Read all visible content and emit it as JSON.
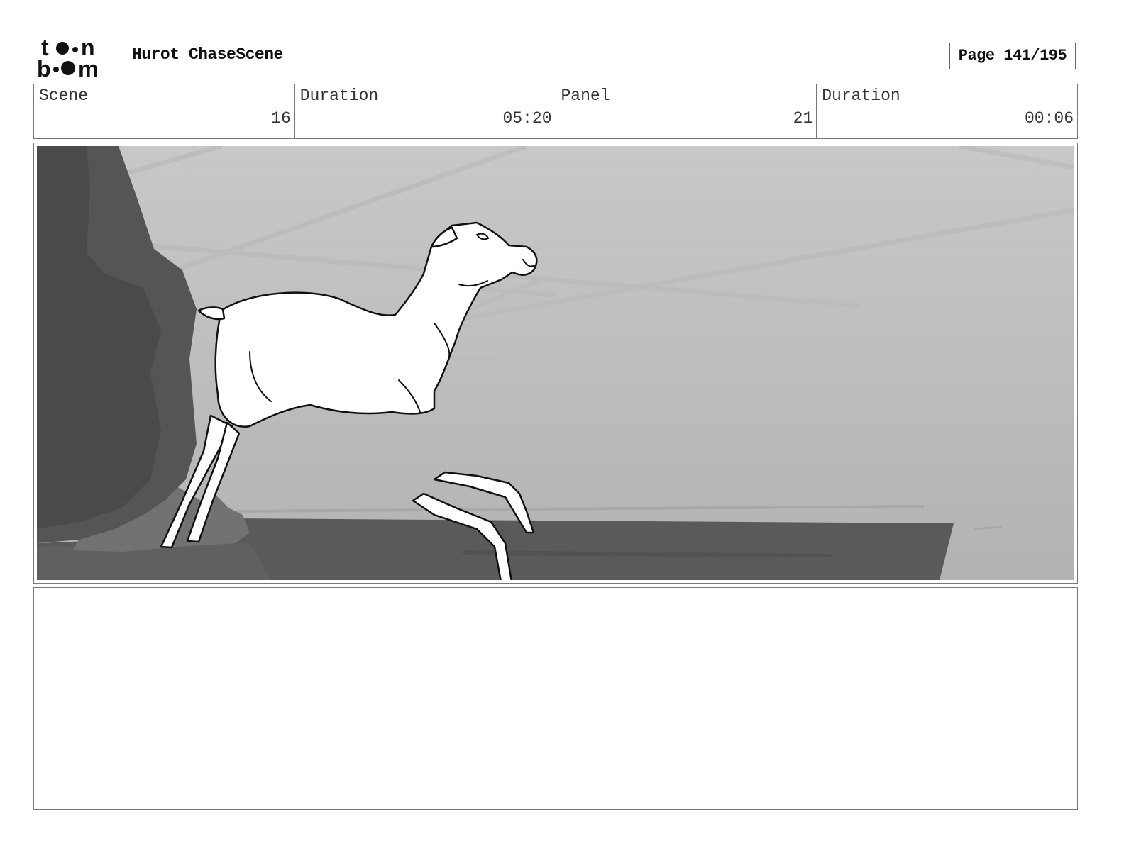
{
  "header": {
    "logo_name": "toonboom-logo",
    "logo_text": "toon boom",
    "title": "Hurot ChaseScene",
    "page_label": "Page 141/195"
  },
  "info": [
    {
      "label": "Scene",
      "value": "16"
    },
    {
      "label": "Duration",
      "value": "05:20"
    },
    {
      "label": "Panel",
      "value": "21"
    },
    {
      "label": "Duration",
      "value": "00:06"
    }
  ],
  "panel": {
    "description": "storyboard-drawing"
  },
  "notes": {
    "text": ""
  }
}
